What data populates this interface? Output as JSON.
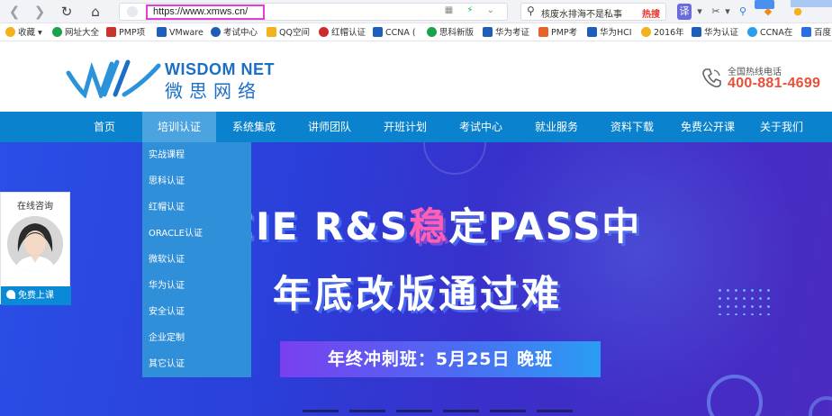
{
  "browser": {
    "url": "https://www.xmws.cn/",
    "search_hint": "核废水排海不是私事",
    "search_hot": "热搜"
  },
  "bookmarks": [
    {
      "label": "收藏",
      "color": "#f3b21b"
    },
    {
      "label": "网址大全",
      "color": "#1aa34a"
    },
    {
      "label": "PMP项",
      "color": "#c8332c"
    },
    {
      "label": "VMware",
      "color": "#1d5fb8"
    },
    {
      "label": "考试中心",
      "color": "#1d5fb8"
    },
    {
      "label": "QQ空间",
      "color": "#f3b21b"
    },
    {
      "label": "红帽认证",
      "color": "#cc2b2b"
    },
    {
      "label": "CCNA (",
      "color": "#1d5fb8"
    },
    {
      "label": "思科新版",
      "color": "#1aa34a"
    },
    {
      "label": "华为考证",
      "color": "#1d5fb8"
    },
    {
      "label": "PMP考",
      "color": "#e8632c"
    },
    {
      "label": "华为HCI",
      "color": "#1d5fb8"
    },
    {
      "label": "2016年",
      "color": "#f3b21b"
    },
    {
      "label": "华为认证",
      "color": "#1d5fb8"
    },
    {
      "label": "CCNA在",
      "color": "#2aa0e8"
    },
    {
      "label": "百度",
      "color": "#2a6fe0"
    }
  ],
  "site": {
    "logo_en": "WISDOM NET",
    "logo_cn": "微思网络",
    "hotline_label": "全国热线电话",
    "hotline_number": "400-881-4699"
  },
  "nav": [
    {
      "label": "首页"
    },
    {
      "label": "培训认证"
    },
    {
      "label": "系统集成"
    },
    {
      "label": "讲师团队"
    },
    {
      "label": "开班计划"
    },
    {
      "label": "考试中心"
    },
    {
      "label": "就业服务"
    },
    {
      "label": "资料下载"
    },
    {
      "label": "免费公开课"
    },
    {
      "label": "关于我们"
    }
  ],
  "dropdown": [
    {
      "label": "实战课程"
    },
    {
      "label": "思科认证"
    },
    {
      "label": "红帽认证"
    },
    {
      "label": "ORACLE认证"
    },
    {
      "label": "微软认证"
    },
    {
      "label": "华为认证"
    },
    {
      "label": "安全认证"
    },
    {
      "label": "企业定制"
    },
    {
      "label": "其它认证"
    }
  ],
  "banner": {
    "headline_pre": "HCIE R&S",
    "headline_accent": "稳",
    "headline_post": "定PASS中",
    "headline2": "年底改版通过难",
    "cta": "年终冲刺班：5月25日 晚班"
  },
  "consult": {
    "title": "在线咨询",
    "button": "免费上课"
  },
  "colors": {
    "nav_bg": "#0a82cd",
    "dropdown_bg": "#2f8fd8",
    "hotline": "#e8503a",
    "brand": "#1c6fc4"
  }
}
